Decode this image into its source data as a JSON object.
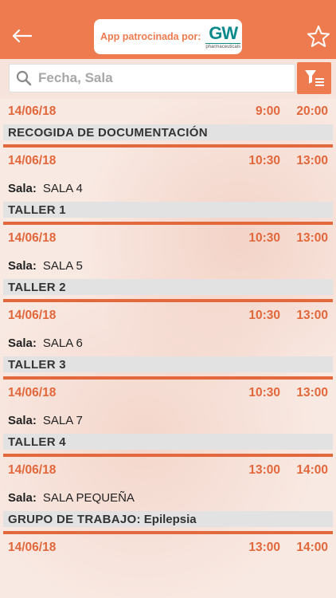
{
  "header": {
    "sponsor_text": "App patrocinada por:",
    "logo_mark": "GW",
    "logo_sub": "pharmaceuticals",
    "back_icon": "arrow-left-icon",
    "favorite_icon": "star-icon"
  },
  "search": {
    "placeholder": "Fecha, Sala",
    "value": ""
  },
  "colors": {
    "accent": "#ee7b4f",
    "date_text": "#e2673b",
    "separator": "#e2693d",
    "title_bar": "#e2e2e2"
  },
  "room_label": "Sala:",
  "entries": [
    {
      "date": "14/06/18",
      "start": "9:00",
      "end": "20:00",
      "room": "",
      "title": "RECOGIDA DE DOCUMENTACIÓN",
      "subtitle": ""
    },
    {
      "date": "14/06/18",
      "start": "10:30",
      "end": "13:00",
      "room": "SALA 4",
      "title": "TALLER 1",
      "subtitle": ""
    },
    {
      "date": "14/06/18",
      "start": "10:30",
      "end": "13:00",
      "room": "SALA 5",
      "title": "TALLER 2",
      "subtitle": ""
    },
    {
      "date": "14/06/18",
      "start": "10:30",
      "end": "13:00",
      "room": "SALA 6",
      "title": "TALLER 3",
      "subtitle": ""
    },
    {
      "date": "14/06/18",
      "start": "10:30",
      "end": "13:00",
      "room": "SALA 7",
      "title": "TALLER 4",
      "subtitle": ""
    },
    {
      "date": "14/06/18",
      "start": "13:00",
      "end": "14:00",
      "room": "SALA PEQUEÑA",
      "title": "GRUPO DE TRABAJO:",
      "subtitle": "Epilepsia"
    },
    {
      "date": "14/06/18",
      "start": "13:00",
      "end": "14:00",
      "room": "",
      "title": "",
      "subtitle": ""
    }
  ]
}
